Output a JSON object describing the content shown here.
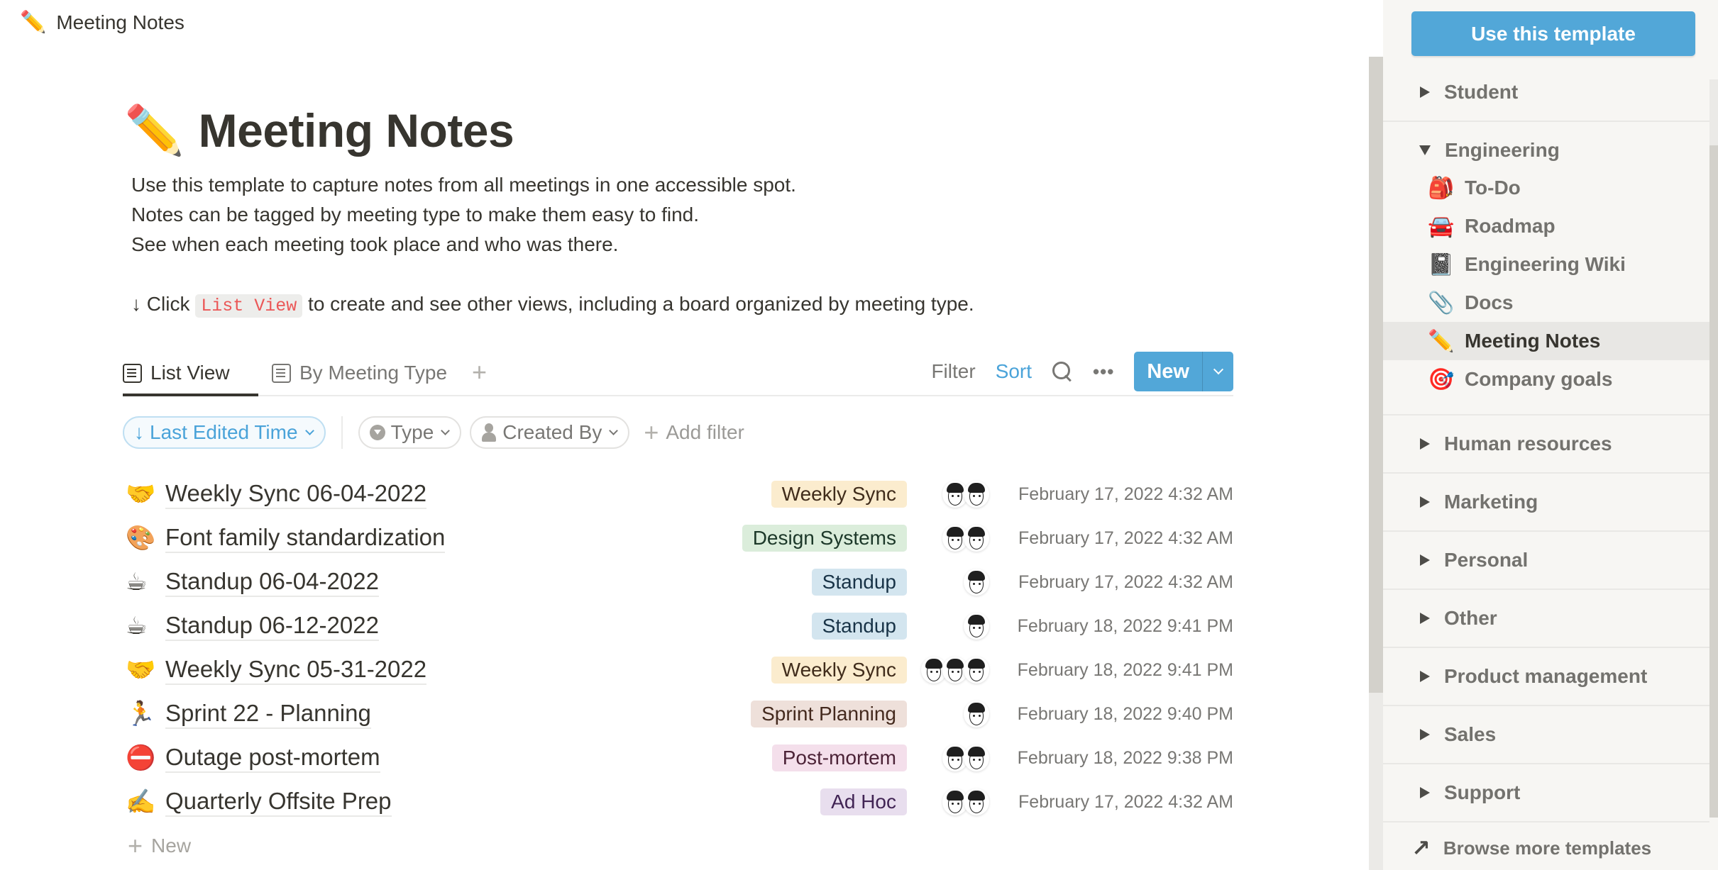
{
  "topbar": {
    "icon": "✏️",
    "title": "Meeting Notes"
  },
  "page": {
    "icon": "✏️",
    "title": "Meeting Notes",
    "description": [
      "Use this template to capture notes from all meetings in one accessible spot.",
      "Notes can be tagged by meeting type to make them easy to find.",
      "See when each meeting took place and who was there."
    ],
    "hint": {
      "prefix": "↓ Click",
      "code": "List View",
      "suffix": "to create and see other views, including a board organized by meeting type."
    }
  },
  "tabs": [
    {
      "label": "List View",
      "icon": "list-view-icon",
      "active": true
    },
    {
      "label": "By Meeting Type",
      "icon": "list-view-icon",
      "active": false
    }
  ],
  "add_view_label": "+",
  "toolbar": {
    "filter": "Filter",
    "sort": "Sort",
    "more": "•••",
    "new": "New"
  },
  "chips": {
    "sort": {
      "arrow": "↓",
      "label": "Last Edited Time"
    },
    "type": "Type",
    "created_by": "Created By",
    "add_filter": "Add filter"
  },
  "colors": {
    "accent": "#52a7d8",
    "link": "#4aa3d9",
    "sidebar_bg": "#f7f6f3"
  },
  "rows": [
    {
      "icon": "🤝",
      "title": "Weekly Sync 06-04-2022",
      "tag": "Weekly Sync",
      "tag_bg": "#fbecce",
      "tag_fg": "#402c1b",
      "avatars": 2,
      "date": "February 17, 2022 4:32 AM"
    },
    {
      "icon": "🎨",
      "title": "Font family standardization",
      "tag": "Design Systems",
      "tag_bg": "#dbeddb",
      "tag_fg": "#1c3829",
      "avatars": 2,
      "date": "February 17, 2022 4:32 AM"
    },
    {
      "icon": "☕",
      "title": "Standup 06-04-2022",
      "tag": "Standup",
      "tag_bg": "#d3e5ef",
      "tag_fg": "#183347",
      "avatars": 1,
      "date": "February 17, 2022 4:32 AM"
    },
    {
      "icon": "☕",
      "title": "Standup 06-12-2022",
      "tag": "Standup",
      "tag_bg": "#d3e5ef",
      "tag_fg": "#183347",
      "avatars": 1,
      "date": "February 18, 2022 9:41 PM"
    },
    {
      "icon": "🤝",
      "title": "Weekly Sync 05-31-2022",
      "tag": "Weekly Sync",
      "tag_bg": "#fbecce",
      "tag_fg": "#402c1b",
      "avatars": 3,
      "date": "February 18, 2022 9:41 PM"
    },
    {
      "icon": "🏃",
      "title": "Sprint 22 - Planning",
      "tag": "Sprint Planning",
      "tag_bg": "#eee0da",
      "tag_fg": "#442a1e",
      "avatars": 1,
      "date": "February 18, 2022 9:40 PM"
    },
    {
      "icon": "⛔",
      "title": "Outage post-mortem",
      "tag": "Post-mortem",
      "tag_bg": "#f4dfeb",
      "tag_fg": "#4c2337",
      "avatars": 2,
      "date": "February 18, 2022 9:38 PM"
    },
    {
      "icon": "✍️",
      "title": "Quarterly Offsite Prep",
      "tag": "Ad Hoc",
      "tag_bg": "#e8deee",
      "tag_fg": "#412454",
      "avatars": 2,
      "date": "February 17, 2022 4:32 AM"
    }
  ],
  "new_row_label": "New",
  "sidebar": {
    "use_template": "Use this template",
    "sections": [
      {
        "label": "Student",
        "expanded": false
      },
      {
        "label": "Engineering",
        "expanded": true,
        "items": [
          {
            "icon": "🎒",
            "label": "To-Do",
            "selected": false
          },
          {
            "icon": "🚘",
            "label": "Roadmap",
            "selected": false
          },
          {
            "icon": "📓",
            "label": "Engineering Wiki",
            "selected": false
          },
          {
            "icon": "📎",
            "label": "Docs",
            "selected": false
          },
          {
            "icon": "✏️",
            "label": "Meeting Notes",
            "selected": true
          },
          {
            "icon": "🎯",
            "label": "Company goals",
            "selected": false
          }
        ]
      },
      {
        "label": "Human resources",
        "expanded": false
      },
      {
        "label": "Marketing",
        "expanded": false
      },
      {
        "label": "Personal",
        "expanded": false
      },
      {
        "label": "Other",
        "expanded": false
      },
      {
        "label": "Product management",
        "expanded": false
      },
      {
        "label": "Sales",
        "expanded": false
      },
      {
        "label": "Support",
        "expanded": false
      }
    ],
    "browse_icon": "↗",
    "browse": "Browse more templates"
  }
}
